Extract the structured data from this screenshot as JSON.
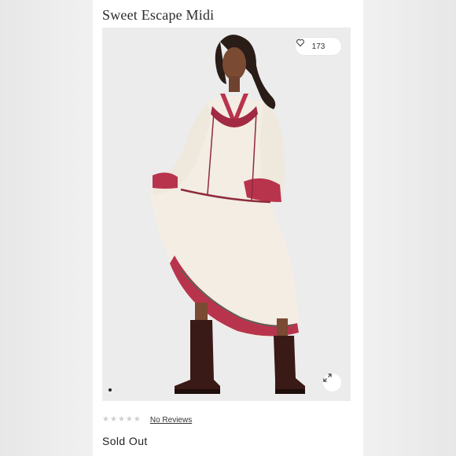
{
  "product": {
    "title": "Sweet Escape Midi",
    "likes_count": "173",
    "rating": {
      "stars_filled": 0,
      "stars_total": 5,
      "reviews_link": "No Reviews"
    },
    "availability": "Sold Out"
  },
  "gallery": {
    "current_slide": 1,
    "expand_icon": "expand-icon",
    "like_icon": "heart-icon"
  },
  "colors": {
    "accent_embroidery": "#b8344c",
    "dress": "#f3ede4",
    "boots": "#3a1a16",
    "background": "#ececec"
  }
}
